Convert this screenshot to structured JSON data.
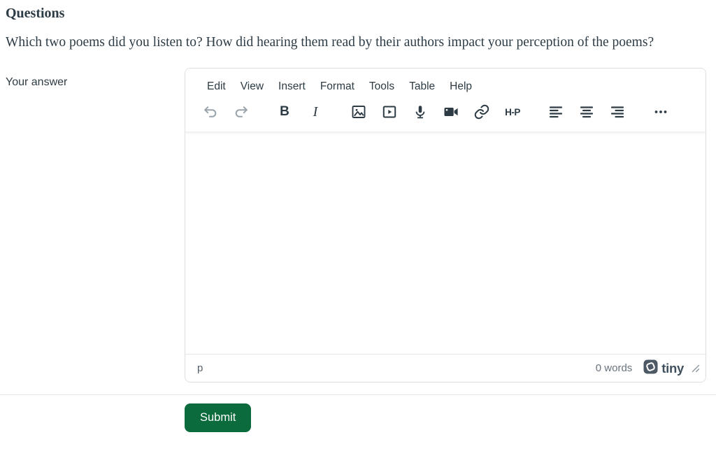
{
  "page": {
    "heading": "Questions",
    "question": "Which two poems did you listen to? How did hearing them read by their authors impact your perception of the poems?",
    "answer_label": "Your answer",
    "submit_label": "Submit"
  },
  "editor": {
    "menu": [
      "Edit",
      "View",
      "Insert",
      "Format",
      "Tools",
      "Table",
      "Help"
    ],
    "toolbar_icons": [
      "undo",
      "redo",
      "bold",
      "italic",
      "insert-image",
      "insert-video",
      "record-audio",
      "record-video",
      "insert-link",
      "insert-h5p",
      "align-left",
      "align-center",
      "align-right",
      "more-options"
    ],
    "glyphs": {
      "bold": "B",
      "italic": "I",
      "h5p": "H-P"
    },
    "content_value": "",
    "statusbar": {
      "element_path": "p",
      "word_count": "0 words",
      "brand": "tiny"
    }
  },
  "colors": {
    "ink": "#2d3b45",
    "muted_text": "#68737d",
    "disabled_icon": "#99a3ab",
    "editor_border": "#dcdfe2",
    "submit_bg": "#0b6b3d"
  }
}
